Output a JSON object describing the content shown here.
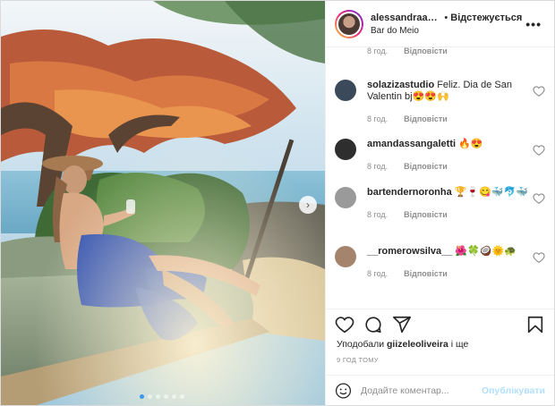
{
  "header": {
    "username": "alessandraambros",
    "separator": "•",
    "following_label": "Відстежується",
    "location": "Bar do Meio",
    "more_icon": "more-horizontal-icon"
  },
  "media": {
    "carousel_dots": 6,
    "active_dot": 0,
    "next_icon": "chevron-right-icon"
  },
  "comments": [
    {
      "username": "solazizastudio",
      "text": "Feliz. Dia de San Valentin bj😍😍🙌",
      "time": "8 год.",
      "reply": "Відповісти",
      "avatar_color": "#3a4a5a"
    },
    {
      "username": "amandassangaletti",
      "text": "🔥😍",
      "time": "8 год.",
      "reply": "Відповісти",
      "avatar_color": "#2e2e2e"
    },
    {
      "username": "bartendernoronha",
      "text": "🏆🍷😋🐳🐬🐳",
      "time": "8 год.",
      "reply": "Відповісти",
      "avatar_color": "#9a9a9a"
    },
    {
      "username": "__romerowsilva__",
      "text": "🌺🍀🥥🌞🐢",
      "time": "8 год.",
      "reply": "Відповісти",
      "avatar_color": "#a5846d"
    }
  ],
  "first_comment_stub": {
    "time": "8 год.",
    "reply": "Відповісти"
  },
  "actions": {
    "like_icon": "heart-icon",
    "comment_icon": "comment-icon",
    "share_icon": "share-icon",
    "save_icon": "bookmark-icon"
  },
  "likes": {
    "prefix": "Уподобали ",
    "user": "giizeleoliveira",
    "suffix": " і ще"
  },
  "timestamp": "9 год тому",
  "add_comment": {
    "placeholder": "Додайте коментар...",
    "post_label": "Опублікувати",
    "emoji_icon": "emoji-icon"
  },
  "colors": {
    "accent": "#3897f0",
    "post_disabled": "#b2dffc",
    "muted": "#8e8e8e"
  }
}
